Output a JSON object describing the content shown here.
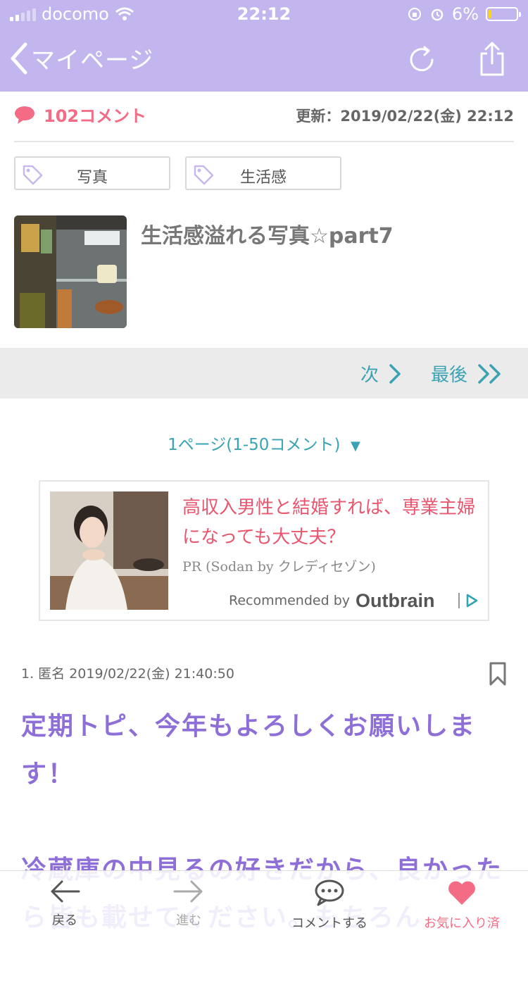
{
  "status_bar": {
    "carrier": "docomo",
    "time": "22:12",
    "battery_pct": "6%"
  },
  "nav": {
    "back_label": "マイページ"
  },
  "meta": {
    "comment_count": "102コメント",
    "updated": "更新：2019/02/22(金) 22:12"
  },
  "tags": [
    {
      "label": "写真"
    },
    {
      "label": "生活感"
    }
  ],
  "topic": {
    "title": "生活感溢れる写真☆part7"
  },
  "pager": {
    "next": "次",
    "last": "最後",
    "page_select": "1ページ(1-50コメント)",
    "page_arrow": "▼"
  },
  "ad": {
    "headline": "高収入男性と結婚すれば、専業主婦になっても大丈夫？",
    "source": "PR (Sodan by クレディセゾン)",
    "recommended_by": "Recommended by",
    "brand": "Outbrain"
  },
  "comment": {
    "meta": "1. 匿名 2019/02/22(金) 21:40:50",
    "line1": "定期トピ、今年もよろしくお願いします！",
    "line2": "冷蔵庫の中見るの好きだから、良かったら皆も載せてください。もちろん"
  },
  "tabbar": {
    "back": "戻る",
    "forward": "進む",
    "comment": "コメントする",
    "favorite": "お気に入り済"
  },
  "colors": {
    "header": "#c3b5ee",
    "accent_pink": "#f36b84",
    "accent_teal": "#3aa3b3",
    "comment_purple": "#8e6fd8"
  }
}
